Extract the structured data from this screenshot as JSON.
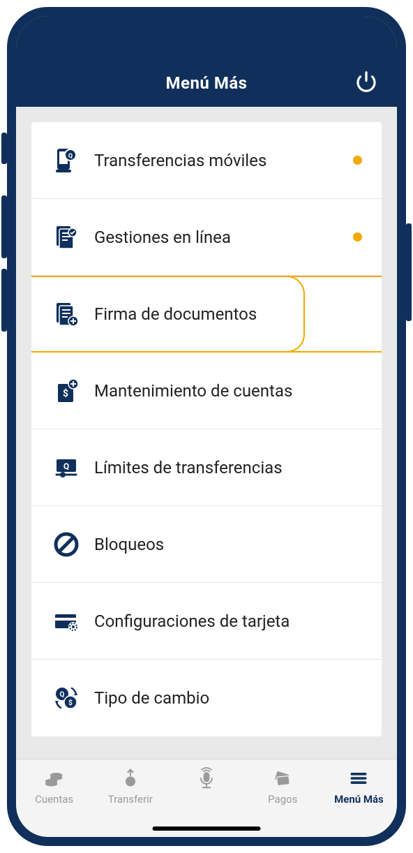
{
  "colors": {
    "primary": "#10305b",
    "accent": "#f2a900",
    "bg": "#e9e9e9"
  },
  "header": {
    "title": "Menú Más",
    "power_icon": "power-icon"
  },
  "menu": {
    "items": [
      {
        "label": "Transferencias móviles",
        "icon": "mobile-transfer-icon",
        "badge": true,
        "highlighted": false
      },
      {
        "label": "Gestiones en línea",
        "icon": "doc-check-icon",
        "badge": true,
        "highlighted": false
      },
      {
        "label": "Firma de documentos",
        "icon": "doc-sign-icon",
        "badge": false,
        "highlighted": true
      },
      {
        "label": "Mantenimiento de cuentas",
        "icon": "account-maint-icon",
        "badge": false,
        "highlighted": false
      },
      {
        "label": "Límites de transferencias",
        "icon": "transfer-limit-icon",
        "badge": false,
        "highlighted": false
      },
      {
        "label": "Bloqueos",
        "icon": "lock-block-icon",
        "badge": false,
        "highlighted": false
      },
      {
        "label": "Configuraciones de tarjeta",
        "icon": "card-config-icon",
        "badge": false,
        "highlighted": false
      },
      {
        "label": "Tipo de cambio",
        "icon": "exchange-icon",
        "badge": false,
        "highlighted": false
      }
    ]
  },
  "bottom_nav": {
    "items": [
      {
        "label": "Cuentas",
        "icon": "coins-icon",
        "active": false
      },
      {
        "label": "Transferir",
        "icon": "transfer-up-icon",
        "active": false
      },
      {
        "label": "",
        "icon": "mic-icon",
        "active": false
      },
      {
        "label": "Pagos",
        "icon": "card-pay-icon",
        "active": false
      },
      {
        "label": "Menú Más",
        "icon": "hamburger-icon",
        "active": true
      }
    ]
  }
}
